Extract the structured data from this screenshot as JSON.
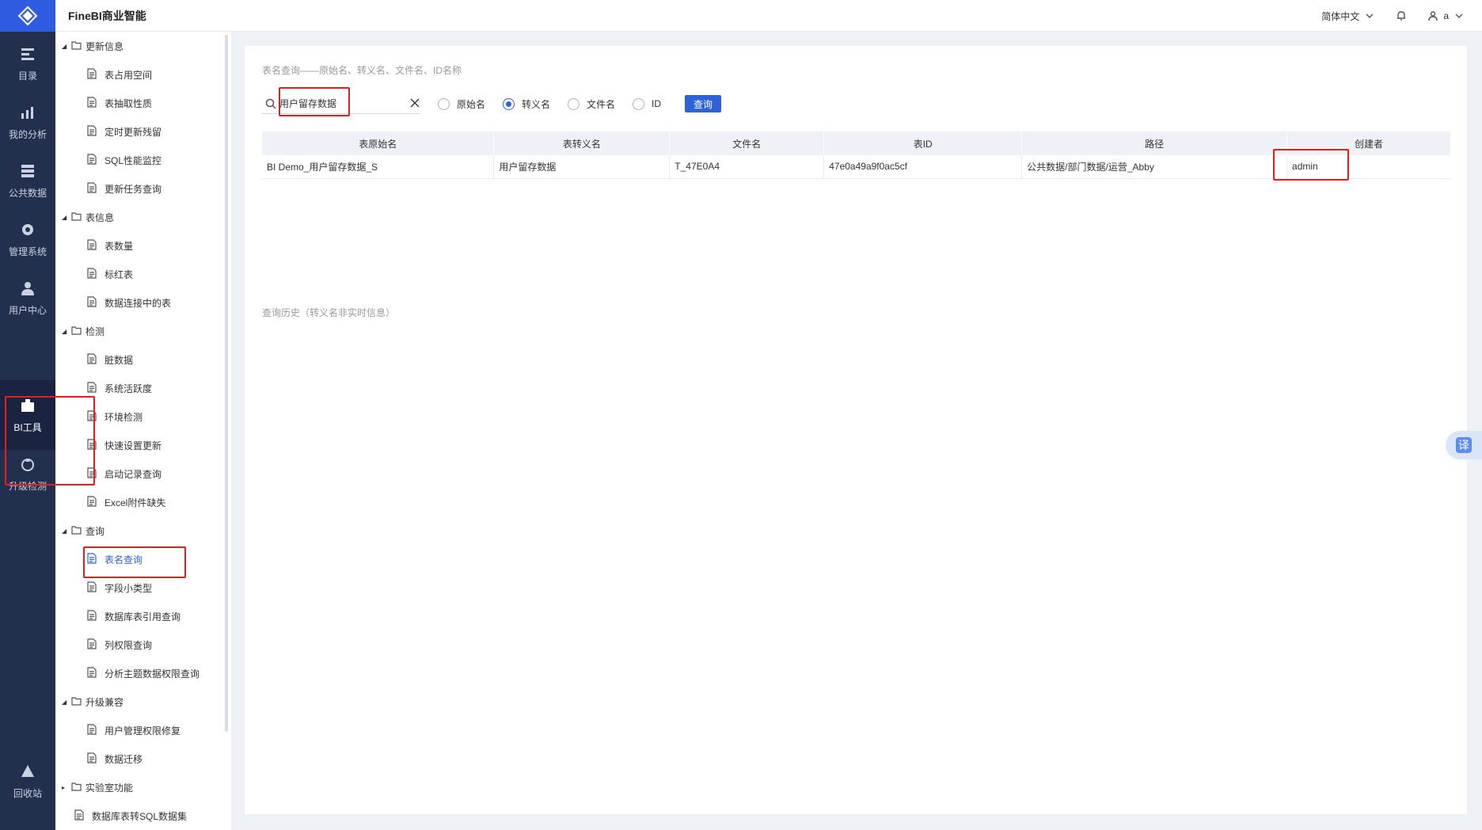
{
  "app": {
    "title": "FineBI商业智能"
  },
  "topbar": {
    "language": "简体中文",
    "user": "a"
  },
  "rail": [
    {
      "label": "目录",
      "icon": "catalog-icon"
    },
    {
      "label": "我的分析",
      "icon": "analysis-icon"
    },
    {
      "label": "公共数据",
      "icon": "database-icon"
    },
    {
      "label": "管理系统",
      "icon": "gear-icon"
    },
    {
      "label": "用户中心",
      "icon": "user-icon"
    },
    {
      "label": "BI工具",
      "icon": "toolbox-icon"
    },
    {
      "label": "升级检测",
      "icon": "upgrade-icon"
    },
    {
      "label": "回收站",
      "icon": "recycle-icon"
    }
  ],
  "tree": [
    {
      "type": "folder",
      "label": "更新信息"
    },
    {
      "type": "leaf",
      "label": "表占用空间"
    },
    {
      "type": "leaf",
      "label": "表抽取性质"
    },
    {
      "type": "leaf",
      "label": "定时更新残留"
    },
    {
      "type": "leaf",
      "label": "SQL性能监控"
    },
    {
      "type": "leaf",
      "label": "更新任务查询"
    },
    {
      "type": "folder",
      "label": "表信息"
    },
    {
      "type": "leaf",
      "label": "表数量"
    },
    {
      "type": "leaf",
      "label": "标红表"
    },
    {
      "type": "leaf",
      "label": "数据连接中的表"
    },
    {
      "type": "folder",
      "label": "检测"
    },
    {
      "type": "leaf",
      "label": "脏数据"
    },
    {
      "type": "leaf",
      "label": "系统活跃度"
    },
    {
      "type": "leaf",
      "label": "环境检测"
    },
    {
      "type": "leaf",
      "label": "快速设置更新"
    },
    {
      "type": "leaf",
      "label": "启动记录查询"
    },
    {
      "type": "leaf",
      "label": "Excel附件缺失"
    },
    {
      "type": "folder",
      "label": "查询"
    },
    {
      "type": "leaf",
      "label": "表名查询",
      "selected": true
    },
    {
      "type": "leaf",
      "label": "字段小类型"
    },
    {
      "type": "leaf",
      "label": "数据库表引用查询"
    },
    {
      "type": "leaf",
      "label": "列权限查询"
    },
    {
      "type": "leaf",
      "label": "分析主题数据权限查询"
    },
    {
      "type": "folder",
      "label": "升级兼容"
    },
    {
      "type": "leaf",
      "label": "用户管理权限修复"
    },
    {
      "type": "leaf",
      "label": "数据迁移"
    },
    {
      "type": "folder-collapsed",
      "label": "实验室功能"
    },
    {
      "type": "leaf2",
      "label": "数据库表转SQL数据集"
    }
  ],
  "main": {
    "hint": "表名查询——原始名、转义名、文件名、ID名称",
    "search_value": "用户留存数据",
    "radios": [
      {
        "label": "原始名",
        "checked": false
      },
      {
        "label": "转义名",
        "checked": true
      },
      {
        "label": "文件名",
        "checked": false
      },
      {
        "label": "ID",
        "checked": false
      }
    ],
    "query_button": "查询",
    "columns": [
      "表原始名",
      "表转义名",
      "文件名",
      "表ID",
      "路径",
      "创建者"
    ],
    "rows": [
      [
        "BI Demo_用户留存数据_S",
        "用户留存数据",
        "T_47E0A4",
        "47e0a49a9f0ac5cf",
        "公共数据/部门数据/运营_Abby",
        "admin"
      ]
    ],
    "history": "查询历史（转义名非实时信息）"
  },
  "translate_label": "译",
  "colors": {
    "accent": "#2e62d9",
    "rail": "#23304d",
    "highlight": "#e02020"
  }
}
